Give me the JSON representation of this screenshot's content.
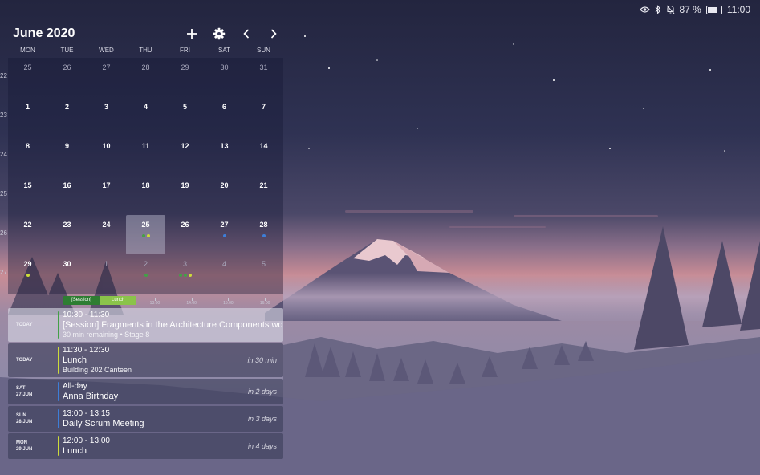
{
  "status": {
    "battery": "87 %",
    "battery_level": 0.87,
    "time": "11:00"
  },
  "calendar": {
    "title": "June 2020",
    "weekdays": [
      "MON",
      "TUE",
      "WED",
      "THU",
      "FRI",
      "SAT",
      "SUN"
    ],
    "weeks": [
      {
        "num": "22",
        "days": [
          {
            "d": "25",
            "other": true
          },
          {
            "d": "26",
            "other": true
          },
          {
            "d": "27",
            "other": true
          },
          {
            "d": "28",
            "other": true
          },
          {
            "d": "29",
            "other": true
          },
          {
            "d": "30",
            "other": true
          },
          {
            "d": "31",
            "other": true
          }
        ]
      },
      {
        "num": "23",
        "days": [
          {
            "d": "1"
          },
          {
            "d": "2"
          },
          {
            "d": "3"
          },
          {
            "d": "4"
          },
          {
            "d": "5"
          },
          {
            "d": "6"
          },
          {
            "d": "7"
          }
        ]
      },
      {
        "num": "24",
        "days": [
          {
            "d": "8"
          },
          {
            "d": "9"
          },
          {
            "d": "10"
          },
          {
            "d": "11"
          },
          {
            "d": "12"
          },
          {
            "d": "13"
          },
          {
            "d": "14"
          }
        ]
      },
      {
        "num": "25",
        "days": [
          {
            "d": "15"
          },
          {
            "d": "16"
          },
          {
            "d": "17"
          },
          {
            "d": "18"
          },
          {
            "d": "19"
          },
          {
            "d": "20"
          },
          {
            "d": "21"
          }
        ]
      },
      {
        "num": "26",
        "days": [
          {
            "d": "22"
          },
          {
            "d": "23"
          },
          {
            "d": "24"
          },
          {
            "d": "25",
            "selected": true,
            "dots": [
              "#43a047",
              "#cddc39"
            ]
          },
          {
            "d": "26"
          },
          {
            "d": "27",
            "dots": [
              "#3d7ed8"
            ]
          },
          {
            "d": "28",
            "dots": [
              "#3d7ed8"
            ]
          }
        ]
      },
      {
        "num": "27",
        "days": [
          {
            "d": "29",
            "dots": [
              "#cddc39"
            ]
          },
          {
            "d": "30"
          },
          {
            "d": "1",
            "other": true
          },
          {
            "d": "2",
            "other": true,
            "dots": [
              "#43a047"
            ]
          },
          {
            "d": "3",
            "other": true,
            "dots": [
              "#43a047",
              "#43a047",
              "#cddc39"
            ]
          },
          {
            "d": "4",
            "other": true
          },
          {
            "d": "5",
            "other": true
          }
        ]
      }
    ]
  },
  "timeline": {
    "blocks": [
      {
        "label": "[Session]",
        "color": "#2e7d32",
        "start": 10.5,
        "end": 11.5
      },
      {
        "label": "Lunch",
        "color": "#8bc34a",
        "start": 11.5,
        "end": 12.5
      }
    ],
    "range": [
      9.0,
      16.5
    ],
    "ticks": [
      13,
      14,
      15,
      16,
      17
    ],
    "tick_labels": [
      {
        "label": "13:00",
        "value": 13
      },
      {
        "label": "14:00",
        "value": 14
      },
      {
        "label": "15:00",
        "value": 15
      },
      {
        "label": "16:00",
        "value": 16
      },
      {
        "label": "17:00",
        "value": 17
      }
    ]
  },
  "agenda": [
    {
      "day": "TODAY",
      "date": "",
      "time": "10:30 - 11:30",
      "title": "[Session] Fragments in the Architecture Components world",
      "subtitle": "30 min remaining  •  Stage 8",
      "relative": "",
      "color": "#43a047",
      "current": true
    },
    {
      "day": "TODAY",
      "date": "",
      "time": "11:30 - 12:30",
      "title": "Lunch",
      "subtitle": "Building 202 Canteen",
      "relative": "in 30 min",
      "color": "#cddc39"
    },
    {
      "day": "SAT",
      "date": "27 JUN",
      "time": "All-day",
      "title": "Anna Birthday",
      "subtitle": "",
      "relative": "in 2 days",
      "color": "#3d7ed8"
    },
    {
      "day": "SUN",
      "date": "28 JUN",
      "time": "13:00 - 13:15",
      "title": "Daily Scrum Meeting",
      "subtitle": "",
      "relative": "in 3 days",
      "color": "#3d7ed8"
    },
    {
      "day": "MON",
      "date": "29 JUN",
      "time": "12:00 - 13:00",
      "title": "Lunch",
      "subtitle": "",
      "relative": "in 4 days",
      "color": "#cddc39"
    }
  ]
}
